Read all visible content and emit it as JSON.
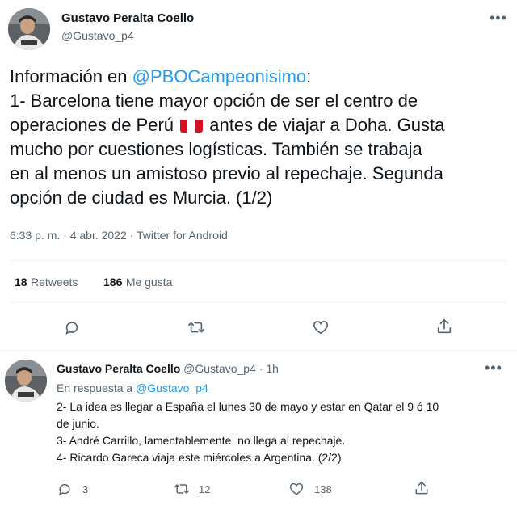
{
  "tweet": {
    "author_name": "Gustavo Peralta Coello",
    "author_handle": "@Gustavo_p4",
    "more_icon": "more-horizontal-icon",
    "text_intro": "Información en ",
    "text_mention": "@PBOCampeonisimo",
    "text_colon": ":",
    "text_line1": "1- Barcelona tiene mayor opción de ser el centro de",
    "text_line2a": "operaciones de Perú",
    "text_line2b": "antes de viajar a Doha. Gusta",
    "text_line3": "mucho por cuestiones logísticas. También se trabaja",
    "text_line4": "en al menos un amistoso previo al repechaje. Segunda",
    "text_line5": "opción de ciudad es Murcia. (1/2)",
    "flag_icon": "peru-flag-icon",
    "timestamp": "6:33 p. m. · 4 abr. 2022 · Twitter for Android",
    "retweets_count": "18",
    "retweets_label": "Retweets",
    "likes_count": "186",
    "likes_label": "Me gusta"
  },
  "reply": {
    "author_name": "Gustavo Peralta Coello",
    "author_handle": "@Gustavo_p4",
    "separator": "·",
    "time": "1h",
    "replying_prefix": "En respuesta a ",
    "replying_handle": "@Gustavo_p4",
    "line1": "2- La idea es llegar a España el lunes 30 de mayo y estar en Qatar el 9 ó 10",
    "line2": "de junio.",
    "line3": "3- André Carrillo, lamentablemente, no llega al repechaje.",
    "line4": "4- Ricardo Gareca viaja este miércoles a Argentina. (2/2)",
    "reply_count": "3",
    "retweet_count": "12",
    "like_count": "138"
  },
  "colors": {
    "accent": "#1d9bf0",
    "muted": "#536471",
    "peru_red": "#d91023"
  }
}
